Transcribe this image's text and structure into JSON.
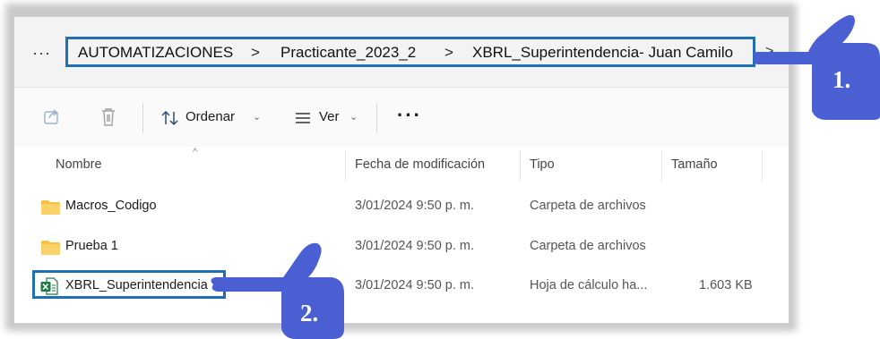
{
  "address": {
    "more": "···",
    "crumbs": [
      "AUTOMATIZACIONES",
      "Practicante_2023_2",
      "XBRL_Superintendencia- Juan Camilo"
    ],
    "separator": ">",
    "overflow_chevron": ">"
  },
  "toolbar": {
    "share_icon": "share-icon",
    "delete_icon": "trash-icon",
    "sort_label": "Ordenar",
    "view_label": "Ver",
    "more": "···",
    "caret": "⌄"
  },
  "columns": {
    "name": "Nombre",
    "date": "Fecha de modificación",
    "type": "Tipo",
    "size": "Tamaño"
  },
  "files": [
    {
      "name": "Macros_Codigo",
      "date": "3/01/2024 9:50 p. m.",
      "type": "Carpeta de archivos",
      "size": "",
      "icon": "folder-icon"
    },
    {
      "name": "Prueba 1",
      "date": "3/01/2024 9:50 p. m.",
      "type": "Carpeta de archivos",
      "size": "",
      "icon": "folder-icon"
    },
    {
      "name": "XBRL_Superintendencia",
      "date": "3/01/2024 9:50 p. m.",
      "type": "Hoja de cálculo ha...",
      "size": "1.603 KB",
      "icon": "excel-file-icon"
    }
  ],
  "annotations": {
    "step1": "1.",
    "step2": "2."
  },
  "colors": {
    "highlight": "#1f6fb3",
    "hand": "#4a5fd1",
    "folder": "#f5c242",
    "excel": "#1d7a44"
  }
}
